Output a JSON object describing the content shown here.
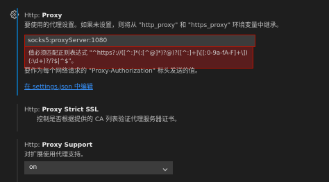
{
  "proxy": {
    "category": "Http:",
    "key": "Proxy",
    "description": "要使用的代理设置。如果未设置，则将从 \"http_proxy\" 和 \"https_proxy\" 环境变量中继承。",
    "value": "socks5:proxyServer:1080",
    "error": "值必须匹配正则表达式 \"^https?://([^:]*(:[^@]*)?@)?([^:]+|\\[[:0-9a-fA-F]+\\])(:\\d+)?/?$|^$\"。"
  },
  "proxy_auth": {
    "description": "要作为每个网络请求的 \"Proxy-Authorization\" 标头发送的值。",
    "link": "在 settings.json 中编辑"
  },
  "strict_ssl": {
    "category": "Http:",
    "key": "Proxy Strict SSL",
    "description": "控制是否根据提供的 CA 列表验证代理服务器证书。"
  },
  "proxy_support": {
    "category": "Http:",
    "key": "Proxy Support",
    "description": "对扩展使用代理支持。",
    "selected": "on"
  },
  "icons": {
    "gear": "gear-icon",
    "chevron": "chevron-down-icon"
  },
  "colors": {
    "background": "#1e1e1e",
    "error_border": "#be1100",
    "error_bg": "#5a1d1d",
    "link": "#3794ff",
    "focus_bar": "#0e639c"
  }
}
